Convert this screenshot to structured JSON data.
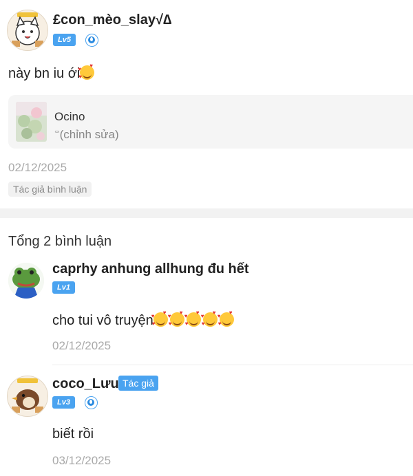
{
  "post": {
    "author": "£con_mèo_slay√∆",
    "level": "Lv5",
    "text": "này bn iu ới",
    "card": {
      "title": "Ocino",
      "subtitle_icon": "cross-ribbon-icon",
      "subtitle": "(chỉnh sửa)"
    },
    "date": "02/12/2025",
    "author_tag": "Tác giả bình luận"
  },
  "comments_header": "Tổng 2 bình luận",
  "comments": [
    {
      "author": "caprhy anhung allhung đu hết",
      "level": "Lv1",
      "text": "cho tui vô truyện",
      "emoji_count": 5,
      "date": "02/12/2025"
    },
    {
      "author": "coco_Lưu",
      "author_badge": "Tác giả",
      "level": "Lv3",
      "text": "biết rồi",
      "date": "03/12/2025"
    }
  ],
  "colors": {
    "accent": "#4aa3f0",
    "muted_text": "#a9a9a9",
    "card_bg": "#f5f5f5"
  }
}
